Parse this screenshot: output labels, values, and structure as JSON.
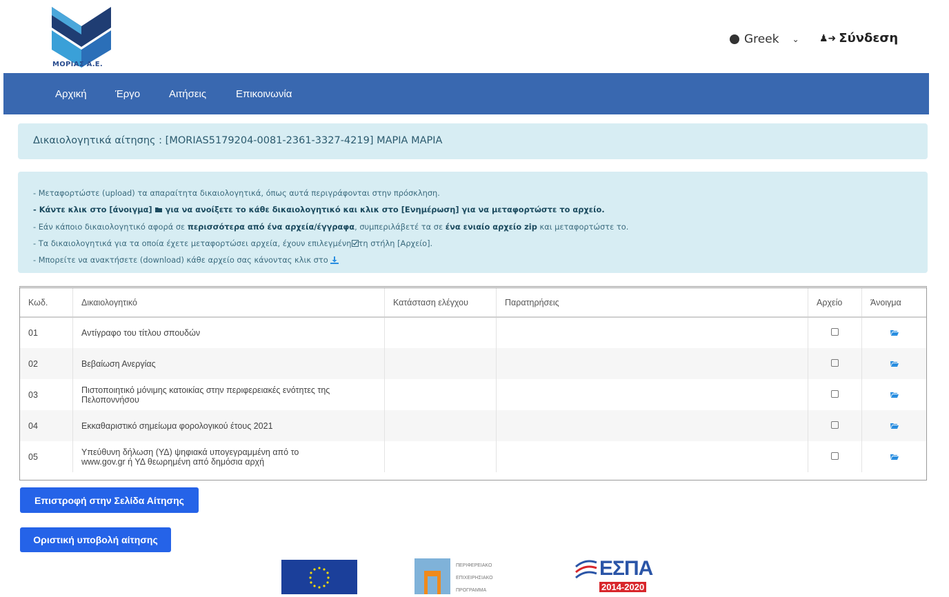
{
  "brand": {
    "logo_text": "ΜΟΡΙΑΣ Α.Ε."
  },
  "header": {
    "language": "Greek",
    "login_label": "Σύνδεση"
  },
  "nav": {
    "items": [
      "Αρχική",
      "Έργο",
      "Αιτήσεις",
      "Επικοινωνία"
    ]
  },
  "page": {
    "title": "Δικαιολογητικά αίτησης : [MORIAS5179204-0081-2361-3327-4219] ΜΑΡΙΑ ΜΑΡΙΑ"
  },
  "instructions": {
    "line1": "- Μεταφορτώστε (upload) τα απαραίτητα δικαιολογητικά, όπως αυτά περιγράφονται στην πρόσκληση.",
    "line2": "- Κάντε κλικ στο [άνοιγμα]",
    "line2b": "για να ανοίξετε το κάθε δικαιολογητικό και κλικ στο [Ενημέρωση] για να μεταφορτώστε το αρχείο.",
    "line3a": "- Εάν κάποιο δικαιολογητικό αφορά σε",
    "line3b": "περισσότερα από ένα αρχεία/έγγραφα",
    "line3c": ", συμπεριλάβετέ τα σε",
    "line3d": "ένα ενιαίο αρχείο zip",
    "line3e": "και μεταφορτώστε το.",
    "line4a": "- Τα δικαιολογητικά για τα οποία έχετε μεταφορτώσει αρχεία, έχουν επιλεγμένη",
    "line4b": "τη στήλη [Αρχείο].",
    "line5": "- Μπορείτε να ανακτήσετε (download) κάθε αρχείο σας κάνοντας κλικ στο"
  },
  "table": {
    "headers": {
      "code": "Κωδ.",
      "document": "Δικαιολογητικό",
      "status": "Κατάσταση ελέγχου",
      "notes": "Παρατηρήσεις",
      "file": "Αρχείο",
      "open": "Άνοιγμα"
    },
    "rows": [
      {
        "code": "01",
        "document": "Αντίγραφο του τίτλου σπουδών",
        "status": "",
        "notes": ""
      },
      {
        "code": "02",
        "document": "Βεβαίωση Ανεργίας",
        "status": "",
        "notes": ""
      },
      {
        "code": "03",
        "document": "Πιστοποιητικό μόνιμης κατοικίας στην περιφερειακές ενότητες της Πελοποννήσου",
        "status": "",
        "notes": ""
      },
      {
        "code": "04",
        "document": "Εκκαθαριστικό σημείωμα φορολογικού έτους 2021",
        "status": "",
        "notes": ""
      },
      {
        "code": "05",
        "document": "Υπεύθυνη δήλωση (ΥΔ) ψηφιακά υπογεγραμμένη από το www.gov.gr ή ΥΔ θεωρημένη από δημόσια αρχή",
        "status": "",
        "notes": ""
      }
    ]
  },
  "buttons": {
    "back": "Επιστροφή στην Σελίδα Αίτησης",
    "submit": "Οριστική υποβολή αίτησης"
  },
  "footer": {
    "pep_lines": [
      "ΠΕΡΙΦΕΡΕΙΑΚΟ",
      "ΕΠΙΧΕΙΡΗΣΙΑΚΟ",
      "ΠΡΟΓΡΑΜΜΑ"
    ],
    "espa_title": "ΕΣΠΑ",
    "espa_years": "2014-2020"
  },
  "colors": {
    "nav_bg": "#3968b0",
    "alert_bg": "#d7edf3",
    "button_bg": "#2563e8",
    "folder_icon": "#2a8ee0"
  }
}
